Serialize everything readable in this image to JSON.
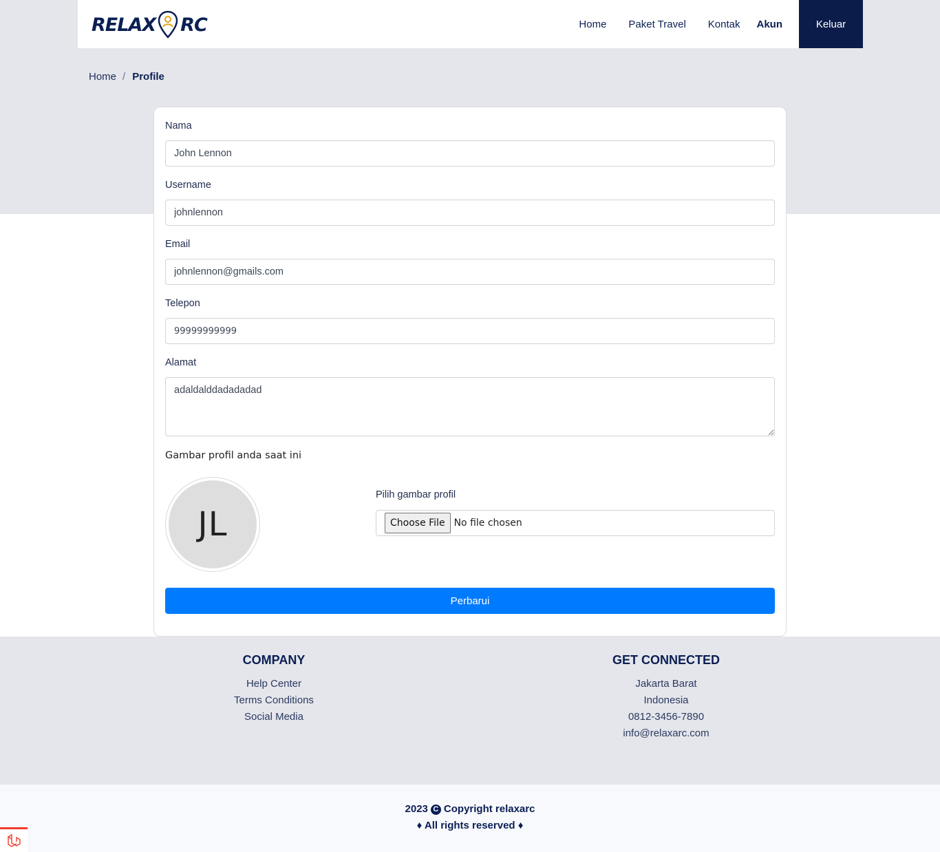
{
  "brand": {
    "left": "RELAX",
    "right": "RC"
  },
  "nav": {
    "items": [
      "Home",
      "Paket Travel",
      "Kontak",
      "Akun"
    ],
    "logout": "Keluar"
  },
  "breadcrumb": {
    "home": "Home",
    "separator": "/",
    "current": "Profile"
  },
  "form": {
    "name_label": "Nama",
    "name_value": "John Lennon",
    "username_label": "Username",
    "username_value": "johnlennon",
    "email_label": "Email",
    "email_value": "johnlennon@gmails.com",
    "phone_label": "Telepon",
    "phone_value": "99999999999",
    "address_label": "Alamat",
    "address_value": "adaldalddadadadad",
    "picture_title": "Gambar profil anda saat ini",
    "avatar_initials": "JL",
    "file_label": "Pilih gambar profil",
    "file_button": "Choose File",
    "file_status": "No file chosen",
    "submit": "Perbarui"
  },
  "footer": {
    "company_title": "COMPANY",
    "company_links": [
      "Help Center",
      "Terms Conditions",
      "Social Media"
    ],
    "connect_title": "GET CONNECTED",
    "connect_items": [
      "Jakarta Barat",
      "Indonesia",
      "0812-3456-7890",
      "info@relaxarc.com"
    ]
  },
  "copyright": {
    "year": "2023",
    "text": "Copyright relaxarc",
    "rights": "♦ All rights reserved ♦"
  },
  "colors": {
    "primary": "#007bff",
    "navy": "#0b1c4a",
    "band": "#e5e6eb"
  }
}
